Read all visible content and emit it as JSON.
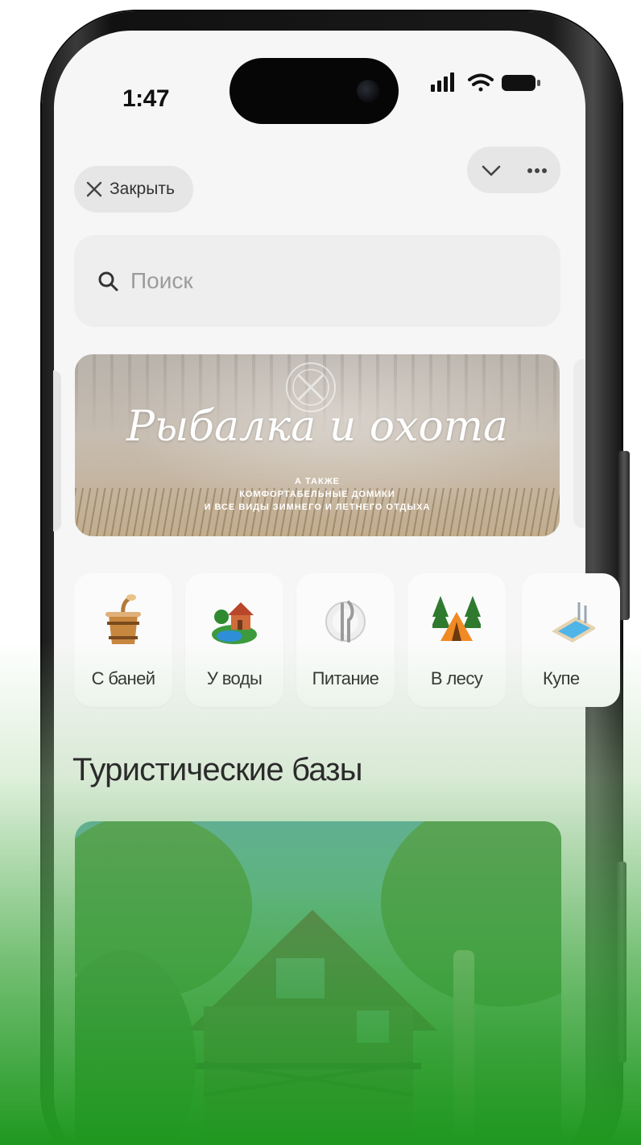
{
  "status_bar": {
    "time": "1:47"
  },
  "header": {
    "close_label": "Закрыть"
  },
  "search": {
    "placeholder": "Поиск"
  },
  "banner": {
    "title": "Рыбалка и охота",
    "subtitle_line1": "А ТАКЖЕ",
    "subtitle_line2": "КОМФОРТАБЕЛЬНЫЕ ДОМИКИ",
    "subtitle_line3": "И ВСЕ ВИДЫ ЗИМНЕГО И ЛЕТНЕГО ОТДЫХА"
  },
  "categories": [
    {
      "label": "С баней",
      "icon": "sauna-bucket-icon"
    },
    {
      "label": "У воды",
      "icon": "lake-house-icon"
    },
    {
      "label": "Питание",
      "icon": "plate-cutlery-icon"
    },
    {
      "label": "В лесу",
      "icon": "forest-tent-icon"
    },
    {
      "label": "Купе",
      "icon": "pool-icon"
    }
  ],
  "section": {
    "title": "Туристические базы"
  },
  "colors": {
    "accent_green": "#1f981f",
    "screen_bg": "#f6f6f6"
  }
}
